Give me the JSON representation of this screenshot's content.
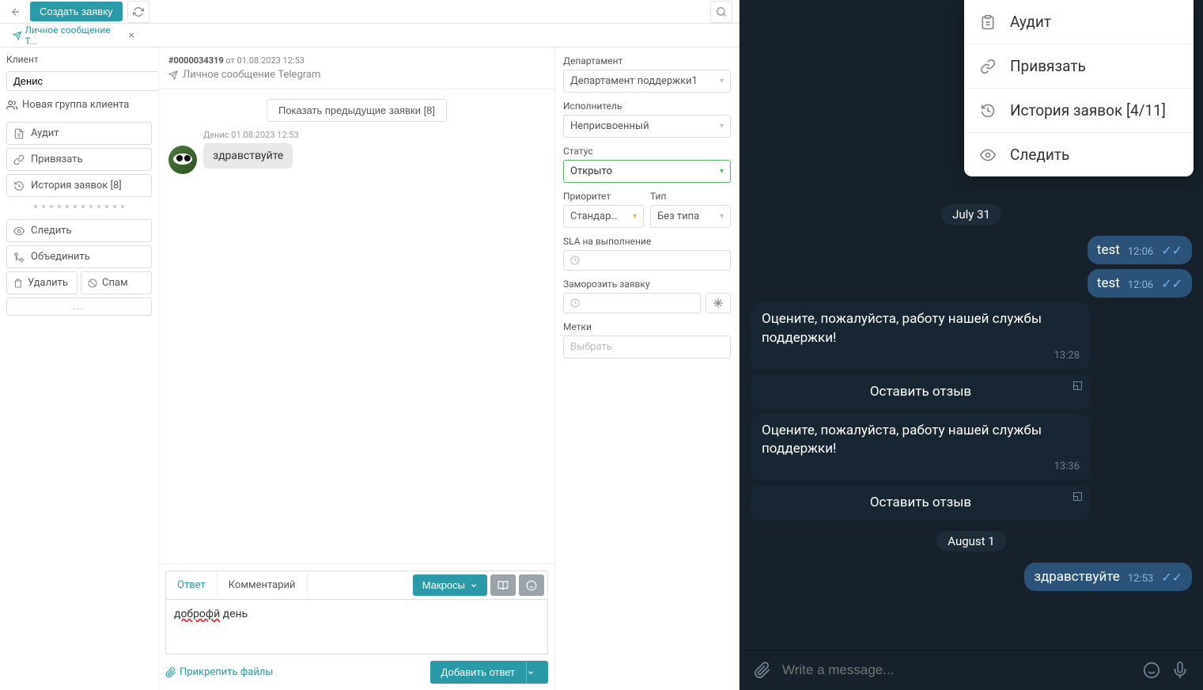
{
  "topbar": {
    "create_label": "Создать заявку"
  },
  "tab": {
    "title": "Личное сообщение Т..."
  },
  "left": {
    "client_label": "Клиент",
    "client_value": "Денис",
    "new_group": "Новая группа клиента",
    "actions": {
      "audit": "Аудит",
      "bind": "Привязать",
      "history": "История заявок [8]",
      "watch": "Следить",
      "merge": "Объединить",
      "delete": "Удалить",
      "spam": "Спам"
    }
  },
  "center": {
    "ticket_id": "#0000034319",
    "ticket_date": "от 01.08.2023 12:53",
    "source": "Личное сообщение Telegram",
    "prev_btn": "Показать предыдущие заявки [8]",
    "msg_meta": "Денис 01.08.2023 12:53",
    "msg_text": "здравствуйте",
    "reply_tab": "Ответ",
    "comment_tab": "Комментарий",
    "macros": "Макросы",
    "draft_typo": "доброфй",
    "draft_rest": " день",
    "attach": "Прикрепить файлы",
    "submit": "Добавить ответ"
  },
  "right": {
    "department_label": "Департамент",
    "department_value": "Департамент поддержки1",
    "executor_label": "Исполнитель",
    "executor_value": "Неприсвоенный",
    "status_label": "Статус",
    "status_value": "Открыто",
    "priority_label": "Приоритет",
    "priority_value": "Стандартно",
    "type_label": "Тип",
    "type_value": "Без типа",
    "sla_label": "SLA на выполнение",
    "freeze_label": "Заморозить заявку",
    "tags_label": "Метки",
    "tags_placeholder": "Выбрать"
  },
  "tg": {
    "menu": {
      "audit": "Аудит",
      "bind": "Привязать",
      "history": "История заявок [4/11]",
      "watch": "Следить"
    },
    "date1": "July 31",
    "date2": "August 1",
    "out1": {
      "text": "test",
      "time": "12:06"
    },
    "out2": {
      "text": "test",
      "time": "12:06"
    },
    "in1": {
      "text": "Оцените, пожалуйста, работу нашей службы поддержки!",
      "time": "13:28"
    },
    "btn1": "Оставить отзыв",
    "in2": {
      "text": "Оцените, пожалуйста, работу нашей службы поддержки!",
      "time": "13:36"
    },
    "btn2": "Оставить отзыв",
    "out3": {
      "text": "здравствуйте",
      "time": "12:53"
    },
    "input_placeholder": "Write a message..."
  }
}
